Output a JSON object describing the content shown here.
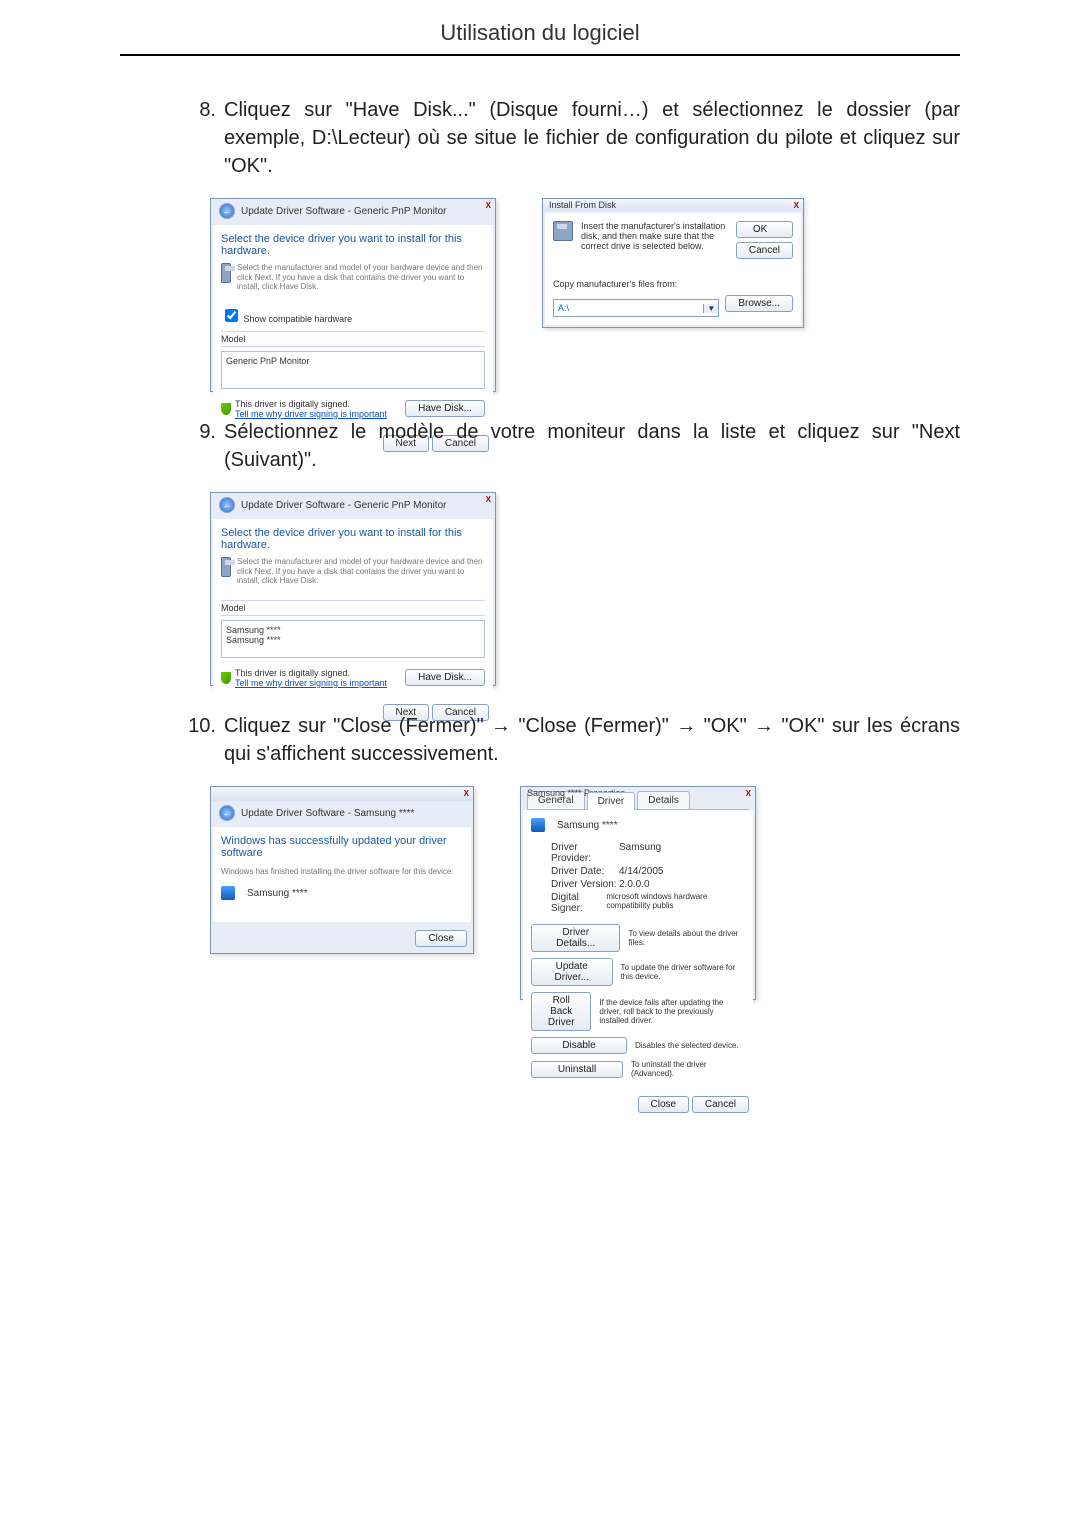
{
  "header": {
    "title": "Utilisation du logiciel"
  },
  "steps": {
    "s8": {
      "num": "8.",
      "text": "Cliquez sur \"Have Disk...\" (Disque fourni…) et sélectionnez le dossier (par exemple, D:\\Lecteur) où se situe le fichier de configuration du pilote et cliquez sur \"OK\"."
    },
    "s9": {
      "num": "9.",
      "text": "Sélectionnez le modèle de votre moniteur dans la liste et cliquez sur \"Next (Suivant)\"."
    },
    "s10": {
      "num": "10.",
      "text": "Cliquez sur \"Close (Fermer)\" → \"Close (Fermer)\" → \"OK\" → \"OK\" sur les écrans qui s'affichent successivement."
    }
  },
  "dlg_update": {
    "title": "Update Driver Software - Generic PnP Monitor",
    "heading": "Select the device driver you want to install for this hardware.",
    "hint": "Select the manufacturer and model of your hardware device and then click Next. If you have a disk that contains the driver you want to install, click Have Disk.",
    "show_compat": "Show compatible hardware",
    "model": "Model",
    "model_item": "Generic PnP Monitor",
    "signed": "This driver is digitally signed.",
    "tell_me": "Tell me why driver signing is important",
    "have_disk": "Have Disk...",
    "next": "Next",
    "cancel": "Cancel"
  },
  "dlg_install": {
    "title": "Install From Disk",
    "instr": "Insert the manufacturer's installation disk, and then make sure that the correct drive is selected below.",
    "ok": "OK",
    "cancel": "Cancel",
    "copy": "Copy manufacturer's files from:",
    "path": "A:\\",
    "browse": "Browse..."
  },
  "dlg_select": {
    "title": "Update Driver Software - Generic PnP Monitor",
    "heading": "Select the device driver you want to install for this hardware.",
    "hint": "Select the manufacturer and model of your hardware device and then click Next. If you have a disk that contains the driver you want to install, click Have Disk.",
    "model": "Model",
    "item1": "Samsung ****",
    "item2": "Samsung ****",
    "signed": "This driver is digitally signed.",
    "tell_me": "Tell me why driver signing is important",
    "have_disk": "Have Disk...",
    "next": "Next",
    "cancel": "Cancel"
  },
  "dlg_done": {
    "title": "Update Driver Software - Samsung ****",
    "heading": "Windows has successfully updated your driver software",
    "sub": "Windows has finished installing the driver software for this device:",
    "device": "Samsung ****",
    "close": "Close"
  },
  "dlg_prop": {
    "title": "Samsung **** Properties",
    "tab_general": "General",
    "tab_driver": "Driver",
    "tab_details": "Details",
    "device": "Samsung ****",
    "rows": {
      "provider_l": "Driver Provider:",
      "provider_v": "Samsung",
      "date_l": "Driver Date:",
      "date_v": "4/14/2005",
      "ver_l": "Driver Version:",
      "ver_v": "2.0.0.0",
      "signer_l": "Digital Signer:",
      "signer_v": "microsoft windows hardware compatibility publis"
    },
    "btn_details": "Driver Details...",
    "txt_details": "To view details about the driver files.",
    "btn_update": "Update Driver...",
    "txt_update": "To update the driver software for this device.",
    "btn_roll": "Roll Back Driver",
    "txt_roll": "If the device fails after updating the driver, roll back to the previously installed driver.",
    "btn_disable": "Disable",
    "txt_disable": "Disables the selected device.",
    "btn_uninst": "Uninstall",
    "txt_uninst": "To uninstall the driver (Advanced).",
    "close": "Close",
    "cancel": "Cancel"
  }
}
